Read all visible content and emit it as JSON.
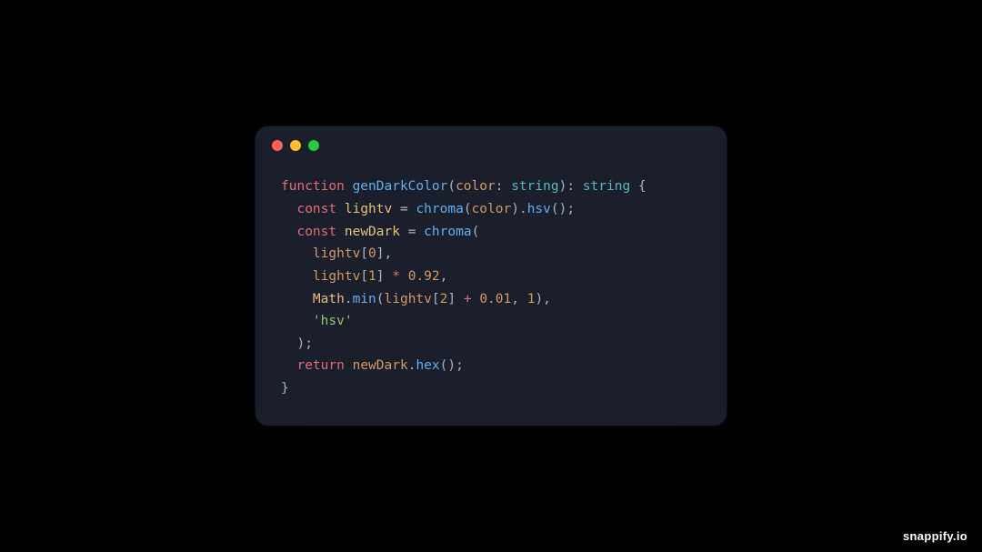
{
  "window": {
    "traffic_lights": [
      "red",
      "yellow",
      "green"
    ]
  },
  "code": {
    "l1": {
      "a": "function",
      "b": "genDarkColor",
      "c": "color",
      "d": "string",
      "e": "string",
      "p1": "(",
      ":": ": ",
      "p2": "): ",
      "brace": " {"
    },
    "l2": {
      "a": "const",
      "b": "lightv",
      "eq": " = ",
      "c": "chroma",
      "p1": "(",
      "d": "color",
      "p2": ").",
      "e": "hsv",
      "p3": "();"
    },
    "l3": {
      "a": "const",
      "b": "newDark",
      "eq": " = ",
      "c": "chroma",
      "p": "("
    },
    "l4": {
      "a": "lightv",
      "b": "0",
      "p1": "[",
      "p2": "],"
    },
    "l5": {
      "a": "lightv",
      "b": "1",
      "c": "0.92",
      "p1": "[",
      "p2": "] ",
      "op": "*",
      "p3": " ",
      "p4": ","
    },
    "l6": {
      "a": "Math",
      "b": "min",
      "c": "lightv",
      "d": "2",
      "e": "0.01",
      "f": "1",
      "p1": ".",
      "p2": "(",
      "p3": "[",
      "p4": "] ",
      "op": "+",
      "p5": " ",
      "p6": ", ",
      "p7": "),"
    },
    "l7": {
      "a": "'hsv'"
    },
    "l8": {
      "p": ");"
    },
    "l9": {
      "a": "return",
      "b": "newDark",
      "c": "hex",
      "p1": " ",
      "p2": ".",
      "p3": "();"
    },
    "l10": {
      "p": "}"
    }
  },
  "watermark": "snappify.io"
}
